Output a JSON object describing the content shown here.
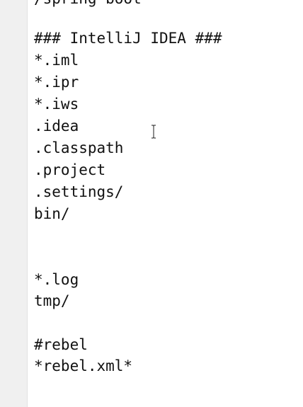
{
  "editor": {
    "lines": [
      "/spring-boot",
      "",
      "### IntelliJ IDEA ###",
      "*.iml",
      "*.ipr",
      "*.iws",
      ".idea",
      ".classpath",
      ".project",
      ".settings/",
      "bin/",
      "",
      "",
      "*.log",
      "tmp/",
      "",
      "#rebel",
      "*rebel.xml*"
    ]
  },
  "cursor": {
    "icon": "text-cursor-icon"
  }
}
